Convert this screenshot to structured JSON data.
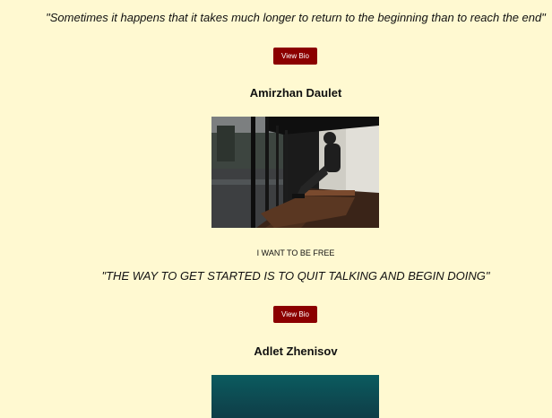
{
  "entries": [
    {
      "quote": "\"Sometimes it happens that it takes much longer to return to the beginning than to reach the end\"",
      "button_label": "View Bio"
    },
    {
      "name": "Amirzhan Daulet",
      "photo_alt": "Person sitting on a bench under a shelter by the water",
      "caption": "I WANT TO BE FREE",
      "quote": "\"THE WAY TO GET STARTED IS TO QUIT TALKING AND BEGIN DOING\"",
      "button_label": "View Bio"
    },
    {
      "name": "Adlet Zhenisov",
      "photo_alt": "Teal sky photo"
    }
  ],
  "colors": {
    "background": "#fff9d1",
    "button": "#8b0000",
    "button_text": "#ffffff"
  }
}
